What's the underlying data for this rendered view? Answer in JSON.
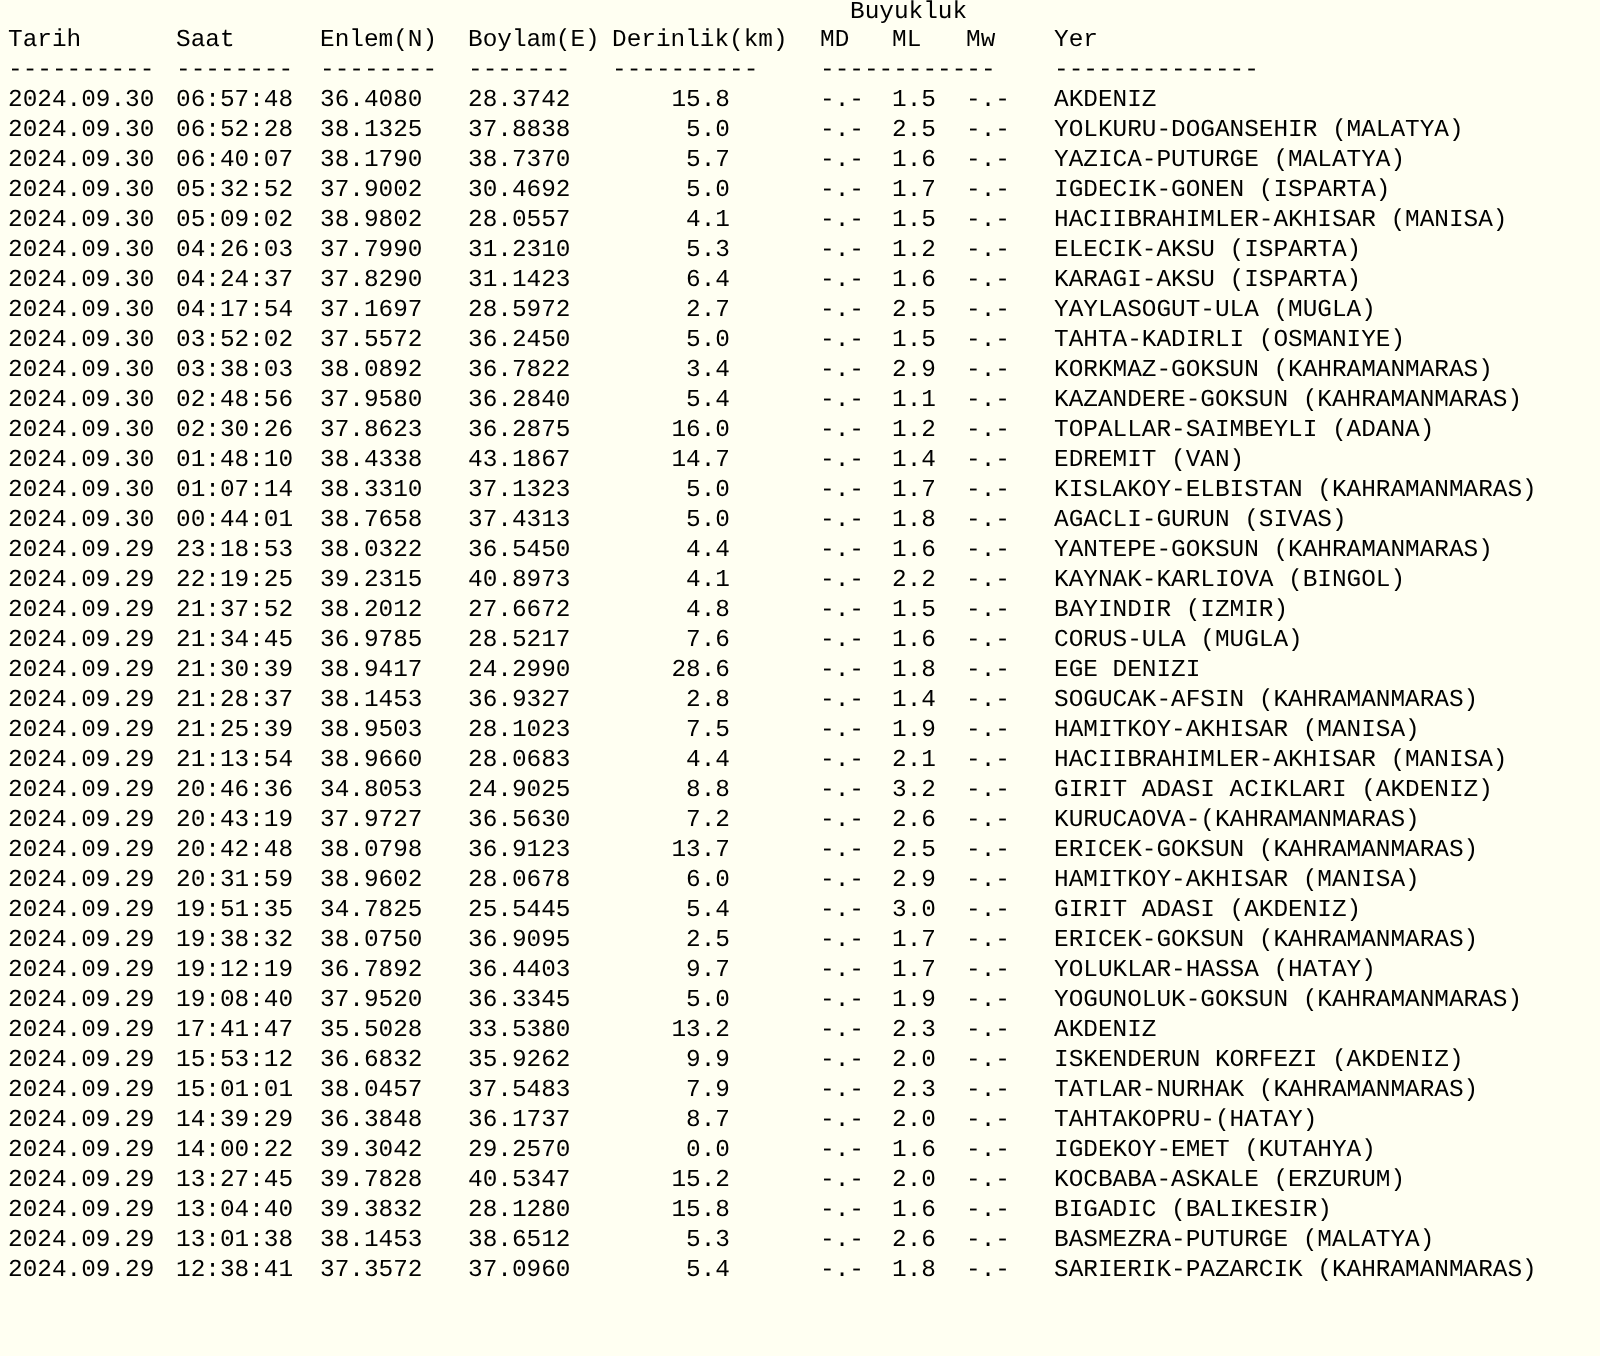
{
  "magnitude_group_label": "Buyukluk",
  "columns": [
    "Tarih",
    "Saat",
    "Enlem(N)",
    "Boylam(E)",
    "Derinlik(km)",
    "MD",
    "ML",
    "Mw",
    "Yer"
  ],
  "separators": [
    {
      "text": "----------",
      "kind": "column"
    },
    {
      "text": "--------",
      "kind": "column"
    },
    {
      "text": "--------",
      "kind": "column"
    },
    {
      "text": "-------",
      "kind": "column"
    },
    {
      "text": "----------",
      "kind": "column"
    },
    {
      "text": "------------",
      "kind": "group"
    },
    {
      "text": "--------------",
      "kind": "column"
    }
  ],
  "rows": [
    [
      "2024.09.30",
      "06:57:48",
      "36.4080",
      "28.3742",
      "15.8",
      "-.-",
      "1.5",
      "-.-",
      "AKDENIZ"
    ],
    [
      "2024.09.30",
      "06:52:28",
      "38.1325",
      "37.8838",
      "5.0",
      "-.-",
      "2.5",
      "-.-",
      "YOLKURU-DOGANSEHIR (MALATYA)"
    ],
    [
      "2024.09.30",
      "06:40:07",
      "38.1790",
      "38.7370",
      "5.7",
      "-.-",
      "1.6",
      "-.-",
      "YAZICA-PUTURGE (MALATYA)"
    ],
    [
      "2024.09.30",
      "05:32:52",
      "37.9002",
      "30.4692",
      "5.0",
      "-.-",
      "1.7",
      "-.-",
      "IGDECIK-GONEN (ISPARTA)"
    ],
    [
      "2024.09.30",
      "05:09:02",
      "38.9802",
      "28.0557",
      "4.1",
      "-.-",
      "1.5",
      "-.-",
      "HACIIBRAHIMLER-AKHISAR (MANISA)"
    ],
    [
      "2024.09.30",
      "04:26:03",
      "37.7990",
      "31.2310",
      "5.3",
      "-.-",
      "1.2",
      "-.-",
      "ELECIK-AKSU (ISPARTA)"
    ],
    [
      "2024.09.30",
      "04:24:37",
      "37.8290",
      "31.1423",
      "6.4",
      "-.-",
      "1.6",
      "-.-",
      "KARAGI-AKSU (ISPARTA)"
    ],
    [
      "2024.09.30",
      "04:17:54",
      "37.1697",
      "28.5972",
      "2.7",
      "-.-",
      "2.5",
      "-.-",
      "YAYLASOGUT-ULA (MUGLA)"
    ],
    [
      "2024.09.30",
      "03:52:02",
      "37.5572",
      "36.2450",
      "5.0",
      "-.-",
      "1.5",
      "-.-",
      "TAHTA-KADIRLI (OSMANIYE)"
    ],
    [
      "2024.09.30",
      "03:38:03",
      "38.0892",
      "36.7822",
      "3.4",
      "-.-",
      "2.9",
      "-.-",
      "KORKMAZ-GOKSUN (KAHRAMANMARAS)"
    ],
    [
      "2024.09.30",
      "02:48:56",
      "37.9580",
      "36.2840",
      "5.4",
      "-.-",
      "1.1",
      "-.-",
      "KAZANDERE-GOKSUN (KAHRAMANMARAS)"
    ],
    [
      "2024.09.30",
      "02:30:26",
      "37.8623",
      "36.2875",
      "16.0",
      "-.-",
      "1.2",
      "-.-",
      "TOPALLAR-SAIMBEYLI (ADANA)"
    ],
    [
      "2024.09.30",
      "01:48:10",
      "38.4338",
      "43.1867",
      "14.7",
      "-.-",
      "1.4",
      "-.-",
      "EDREMIT (VAN)"
    ],
    [
      "2024.09.30",
      "01:07:14",
      "38.3310",
      "37.1323",
      "5.0",
      "-.-",
      "1.7",
      "-.-",
      "KISLAKOY-ELBISTAN (KAHRAMANMARAS)"
    ],
    [
      "2024.09.30",
      "00:44:01",
      "38.7658",
      "37.4313",
      "5.0",
      "-.-",
      "1.8",
      "-.-",
      "AGACLI-GURUN (SIVAS)"
    ],
    [
      "2024.09.29",
      "23:18:53",
      "38.0322",
      "36.5450",
      "4.4",
      "-.-",
      "1.6",
      "-.-",
      "YANTEPE-GOKSUN (KAHRAMANMARAS)"
    ],
    [
      "2024.09.29",
      "22:19:25",
      "39.2315",
      "40.8973",
      "4.1",
      "-.-",
      "2.2",
      "-.-",
      "KAYNAK-KARLIOVA (BINGOL)"
    ],
    [
      "2024.09.29",
      "21:37:52",
      "38.2012",
      "27.6672",
      "4.8",
      "-.-",
      "1.5",
      "-.-",
      "BAYINDIR (IZMIR)"
    ],
    [
      "2024.09.29",
      "21:34:45",
      "36.9785",
      "28.5217",
      "7.6",
      "-.-",
      "1.6",
      "-.-",
      "CORUS-ULA (MUGLA)"
    ],
    [
      "2024.09.29",
      "21:30:39",
      "38.9417",
      "24.2990",
      "28.6",
      "-.-",
      "1.8",
      "-.-",
      "EGE DENIZI"
    ],
    [
      "2024.09.29",
      "21:28:37",
      "38.1453",
      "36.9327",
      "2.8",
      "-.-",
      "1.4",
      "-.-",
      "SOGUCAK-AFSIN (KAHRAMANMARAS)"
    ],
    [
      "2024.09.29",
      "21:25:39",
      "38.9503",
      "28.1023",
      "7.5",
      "-.-",
      "1.9",
      "-.-",
      "HAMITKOY-AKHISAR (MANISA)"
    ],
    [
      "2024.09.29",
      "21:13:54",
      "38.9660",
      "28.0683",
      "4.4",
      "-.-",
      "2.1",
      "-.-",
      "HACIIBRAHIMLER-AKHISAR (MANISA)"
    ],
    [
      "2024.09.29",
      "20:46:36",
      "34.8053",
      "24.9025",
      "8.8",
      "-.-",
      "3.2",
      "-.-",
      "GIRIT ADASI ACIKLARI (AKDENIZ)"
    ],
    [
      "2024.09.29",
      "20:43:19",
      "37.9727",
      "36.5630",
      "7.2",
      "-.-",
      "2.6",
      "-.-",
      "KURUCAOVA-(KAHRAMANMARAS)"
    ],
    [
      "2024.09.29",
      "20:42:48",
      "38.0798",
      "36.9123",
      "13.7",
      "-.-",
      "2.5",
      "-.-",
      "ERICEK-GOKSUN (KAHRAMANMARAS)"
    ],
    [
      "2024.09.29",
      "20:31:59",
      "38.9602",
      "28.0678",
      "6.0",
      "-.-",
      "2.9",
      "-.-",
      "HAMITKOY-AKHISAR (MANISA)"
    ],
    [
      "2024.09.29",
      "19:51:35",
      "34.7825",
      "25.5445",
      "5.4",
      "-.-",
      "3.0",
      "-.-",
      "GIRIT ADASI (AKDENIZ)"
    ],
    [
      "2024.09.29",
      "19:38:32",
      "38.0750",
      "36.9095",
      "2.5",
      "-.-",
      "1.7",
      "-.-",
      "ERICEK-GOKSUN (KAHRAMANMARAS)"
    ],
    [
      "2024.09.29",
      "19:12:19",
      "36.7892",
      "36.4403",
      "9.7",
      "-.-",
      "1.7",
      "-.-",
      "YOLUKLAR-HASSA (HATAY)"
    ],
    [
      "2024.09.29",
      "19:08:40",
      "37.9520",
      "36.3345",
      "5.0",
      "-.-",
      "1.9",
      "-.-",
      "YOGUNOLUK-GOKSUN (KAHRAMANMARAS)"
    ],
    [
      "2024.09.29",
      "17:41:47",
      "35.5028",
      "33.5380",
      "13.2",
      "-.-",
      "2.3",
      "-.-",
      "AKDENIZ"
    ],
    [
      "2024.09.29",
      "15:53:12",
      "36.6832",
      "35.9262",
      "9.9",
      "-.-",
      "2.0",
      "-.-",
      "ISKENDERUN KORFEZI (AKDENIZ)"
    ],
    [
      "2024.09.29",
      "15:01:01",
      "38.0457",
      "37.5483",
      "7.9",
      "-.-",
      "2.3",
      "-.-",
      "TATLAR-NURHAK (KAHRAMANMARAS)"
    ],
    [
      "2024.09.29",
      "14:39:29",
      "36.3848",
      "36.1737",
      "8.7",
      "-.-",
      "2.0",
      "-.-",
      "TAHTAKOPRU-(HATAY)"
    ],
    [
      "2024.09.29",
      "14:00:22",
      "39.3042",
      "29.2570",
      "0.0",
      "-.-",
      "1.6",
      "-.-",
      "IGDEKOY-EMET (KUTAHYA)"
    ],
    [
      "2024.09.29",
      "13:27:45",
      "39.7828",
      "40.5347",
      "15.2",
      "-.-",
      "2.0",
      "-.-",
      "KOCBABA-ASKALE (ERZURUM)"
    ],
    [
      "2024.09.29",
      "13:04:40",
      "39.3832",
      "28.1280",
      "15.8",
      "-.-",
      "1.6",
      "-.-",
      "BIGADIC (BALIKESIR)"
    ],
    [
      "2024.09.29",
      "13:01:38",
      "38.1453",
      "38.6512",
      "5.3",
      "-.-",
      "2.6",
      "-.-",
      "BASMEZRA-PUTURGE (MALATYA)"
    ],
    [
      "2024.09.29",
      "12:38:41",
      "37.3572",
      "37.0960",
      "5.4",
      "-.-",
      "1.8",
      "-.-",
      "SARIERIK-PAZARCIK (KAHRAMANMARAS)"
    ]
  ]
}
